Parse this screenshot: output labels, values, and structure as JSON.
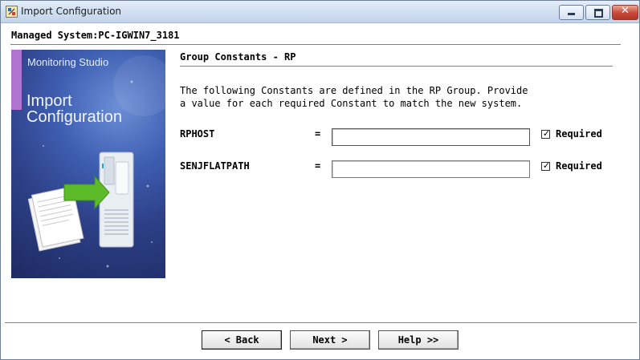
{
  "window": {
    "title": "Import Configuration",
    "controls": {
      "close_glyph": "✕"
    }
  },
  "header": {
    "managed_system": "Managed System:PC-IGWIN7_3181"
  },
  "banner": {
    "brand": "Monitoring Studio",
    "title_line1": "Import",
    "title_line2": "Configuration",
    "accent_color": "#b074d0"
  },
  "group": {
    "title": "Group Constants - RP",
    "description_line1": "The following Constants are defined in the RP Group. Provide",
    "description_line2": "a value for each required Constant to match the new system."
  },
  "constants": [
    {
      "name": "RPHOST",
      "equals": "=",
      "value": "",
      "required_checked": true,
      "check_glyph": "✓",
      "required_label": "Required"
    },
    {
      "name": "SENJFLATPATH",
      "equals": "=",
      "value": "",
      "required_checked": true,
      "check_glyph": "✓",
      "required_label": "Required"
    }
  ],
  "buttons": {
    "back": "< Back",
    "next": "Next >",
    "help": "Help >>"
  }
}
